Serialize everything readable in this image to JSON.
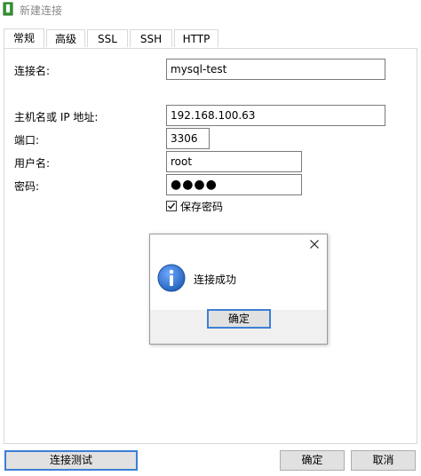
{
  "window": {
    "title": "新建连接",
    "icon": "app-icon"
  },
  "tabs": [
    {
      "label": "常规",
      "active": true
    },
    {
      "label": "高级",
      "active": false
    },
    {
      "label": "SSL",
      "active": false
    },
    {
      "label": "SSH",
      "active": false
    },
    {
      "label": "HTTP",
      "active": false
    }
  ],
  "form": {
    "connection_name": {
      "label": "连接名:",
      "value": "mysql-test"
    },
    "host": {
      "label": "主机名或 IP 地址:",
      "value": "192.168.100.63"
    },
    "port": {
      "label": "端口:",
      "value": "3306"
    },
    "username": {
      "label": "用户名:",
      "value": "root"
    },
    "password": {
      "label": "密码:",
      "value": "●●●●"
    },
    "save_password": {
      "label": "保存密码",
      "checked": true
    }
  },
  "dialog": {
    "message": "连接成功",
    "ok_label": "确定",
    "icon": "info-icon"
  },
  "footer": {
    "test_label": "连接测试",
    "ok_label": "确定",
    "cancel_label": "取消"
  },
  "colors": {
    "accent": "#3c7fd6",
    "info_icon": "#1f5fb8"
  }
}
